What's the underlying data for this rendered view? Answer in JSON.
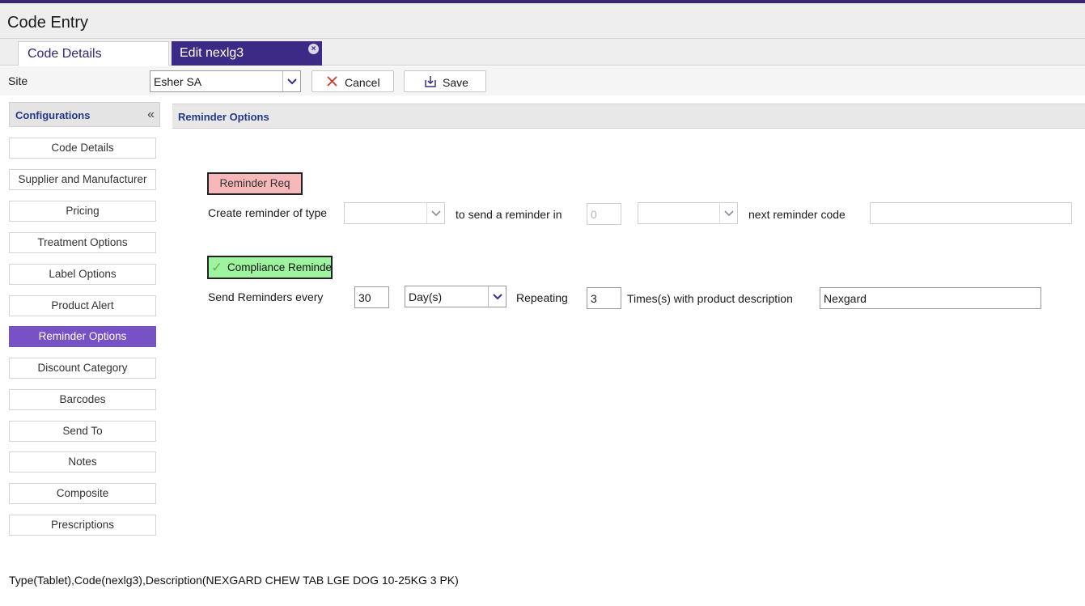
{
  "app": {
    "title": "Code Entry"
  },
  "tabs": {
    "code_details": "Code Details",
    "edit": "Edit nexlg3"
  },
  "toolbar": {
    "site_label": "Site",
    "site_value": "Esher SA",
    "cancel_label": "Cancel",
    "save_label": "Save"
  },
  "sidebar": {
    "header": "Configurations",
    "items": [
      {
        "label": "Code Details"
      },
      {
        "label": "Supplier and Manufacturer"
      },
      {
        "label": "Pricing"
      },
      {
        "label": "Treatment Options"
      },
      {
        "label": "Label Options"
      },
      {
        "label": "Product Alert"
      },
      {
        "label": "Reminder Options",
        "active": true
      },
      {
        "label": "Discount Category"
      },
      {
        "label": "Barcodes"
      },
      {
        "label": "Send To"
      },
      {
        "label": "Notes"
      },
      {
        "label": "Composite"
      },
      {
        "label": "Prescriptions"
      }
    ]
  },
  "main": {
    "header": "Reminder Options",
    "reminder_req_label": "Reminder Req",
    "create_reminder_label": "Create reminder of type",
    "reminder_type_value": "",
    "send_reminder_in_label": "to send a reminder in",
    "send_in_value": "0",
    "send_in_unit_value": "",
    "next_code_label": "next reminder code",
    "next_code_value": "",
    "compliance_label": "Compliance Reminder",
    "send_every_label": "Send Reminders every",
    "every_value": "30",
    "every_unit_value": "Day(s)",
    "repeating_label": "Repeating",
    "repeat_value": "3",
    "times_label": "Times(s) with product description",
    "description_value": "Nexgard"
  },
  "footer": {
    "text": "Type(Tablet),Code(nexlg3),Description(NEXGARD CHEW TAB LGE DOG 10-25KG 3 PK)"
  },
  "colors": {
    "accent": "#7752c6",
    "tab_active": "#3d2a86",
    "reminder_req_bg": "#f6b8b8",
    "compliance_bg": "#9ef39e"
  }
}
